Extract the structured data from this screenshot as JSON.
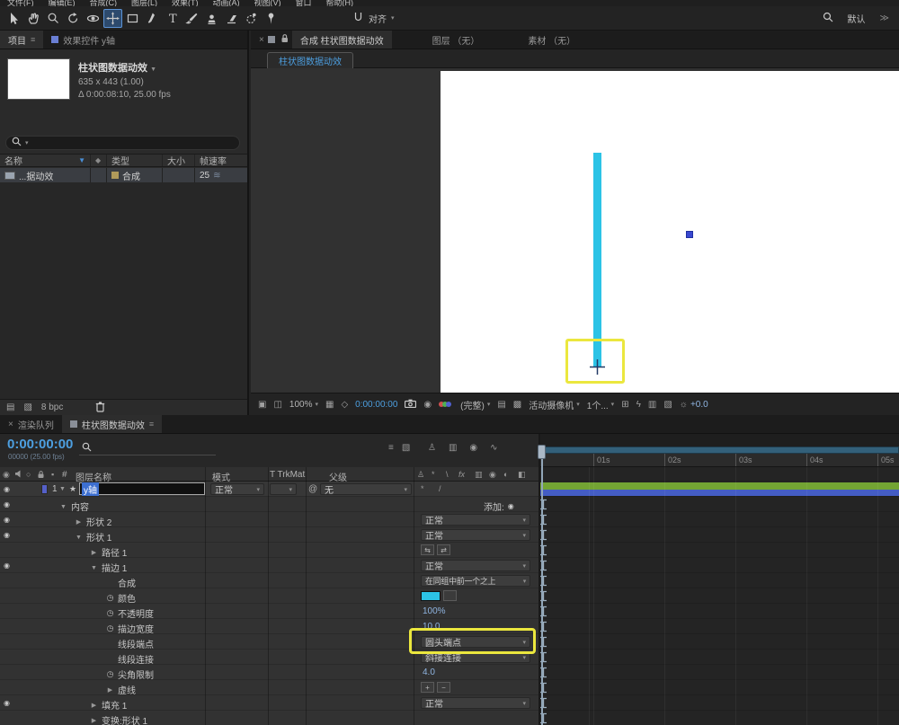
{
  "colors": {
    "accent-blue": "#4a90d8",
    "stroke-cyan": "#2cc3e6",
    "highlight-yellow": "#ebe73e",
    "value-blue": "#8fb4e0",
    "timecode-blue": "#4d9fe0",
    "selection-blue": "#3d6fd0",
    "bar-green": "#73a433",
    "bar-blue": "#445dc4",
    "dot-blue": "#3948d0"
  },
  "menubar": {
    "items": [
      "文件(F)",
      "编辑(E)",
      "合成(C)",
      "图层(L)",
      "效果(T)",
      "动画(A)",
      "视图(V)",
      "窗口",
      "帮助(H)"
    ]
  },
  "toolbar": {
    "tools": [
      "selection-tool",
      "hand-tool",
      "zoom-tool",
      "rotate-tool",
      "camera-tool",
      "pan-behind-tool",
      "rectangle-tool",
      "pen-tool",
      "type-tool",
      "brush-tool",
      "clone-stamp-tool",
      "eraser-tool",
      "roto-brush-tool",
      "puppet-pin-tool"
    ],
    "selected_tool": "pan-behind-tool",
    "snap_label": "对齐",
    "workspace_label": "默认"
  },
  "project": {
    "tab_project": "项目",
    "tab_effects": "效果控件 y轴",
    "comp_name": "柱状图数据动效",
    "comp_dims": "635 x 443 (1.00)",
    "comp_time": "Δ 0:00:08:10, 25.00 fps",
    "columns": {
      "name": "名称",
      "type": "类型",
      "size": "大小",
      "fps": "帧速率"
    },
    "row": {
      "name": "...据动效",
      "type": "合成",
      "fps": "25"
    },
    "bpc": "8 bpc"
  },
  "viewer": {
    "tab_comp": "合成 柱状图数据动效",
    "tab_layer": "图层 （无）",
    "tab_footage": "素材 （无）",
    "comp_tab": "柱状图数据动效",
    "zoom": "100%",
    "timecode": "0:00:00:00",
    "resolution": "(完整)",
    "view": "活动摄像机",
    "layout": "1个...",
    "exposure": "+0.0"
  },
  "timeline": {
    "tab_render": "渲染队列",
    "tab_comp": "柱状图数据动效",
    "timecode": "0:00:00:00",
    "frames": "00000 (25.00 fps)",
    "headers": {
      "num": "#",
      "name": "图层名称",
      "mode": "模式",
      "trkmat": "T TrkMat",
      "parent": "父级"
    },
    "layer": {
      "num": "1",
      "name": "y轴",
      "mode": "正常",
      "parent": "无"
    },
    "ruler": [
      "01s",
      "02s",
      "03s",
      "04s",
      "05s"
    ],
    "rows": [
      {
        "label": "内容",
        "indent": 1,
        "twirl": "down",
        "eye": true,
        "add": "添加:"
      },
      {
        "label": "形状 2",
        "indent": 2,
        "twirl": "right",
        "eye": true,
        "dropdown": "正常"
      },
      {
        "label": "形状 1",
        "indent": 2,
        "twirl": "down",
        "eye": true,
        "dropdown": "正常"
      },
      {
        "label": "路径 1",
        "indent": 3,
        "twirl": "right",
        "icons": true
      },
      {
        "label": "描边 1",
        "indent": 3,
        "twirl": "down",
        "eye": true,
        "dropdown": "正常"
      },
      {
        "label": "合成",
        "indent": 4,
        "dropdown": "在同组中前一个之上",
        "wide": true
      },
      {
        "label": "颜色",
        "indent": 4,
        "stopwatch": true,
        "swatch": true
      },
      {
        "label": "不透明度",
        "indent": 4,
        "stopwatch": true,
        "value": "100%"
      },
      {
        "label": "描边宽度",
        "indent": 4,
        "stopwatch": true,
        "value": "10.0"
      },
      {
        "label": "线段端点",
        "indent": 4,
        "dropdown": "圆头端点",
        "highlight": true
      },
      {
        "label": "线段连接",
        "indent": 4,
        "dropdown": "斜接连接"
      },
      {
        "label": "尖角限制",
        "indent": 4,
        "stopwatch": true,
        "value": "4.0"
      },
      {
        "label": "虚线",
        "indent": 4,
        "twirl": "right",
        "plusminus": true
      },
      {
        "label": "填充 1",
        "indent": 3,
        "twirl": "right",
        "eye": true,
        "dropdown": "正常"
      },
      {
        "label": "变换:形状 1",
        "indent": 3,
        "twirl": "right"
      }
    ]
  }
}
